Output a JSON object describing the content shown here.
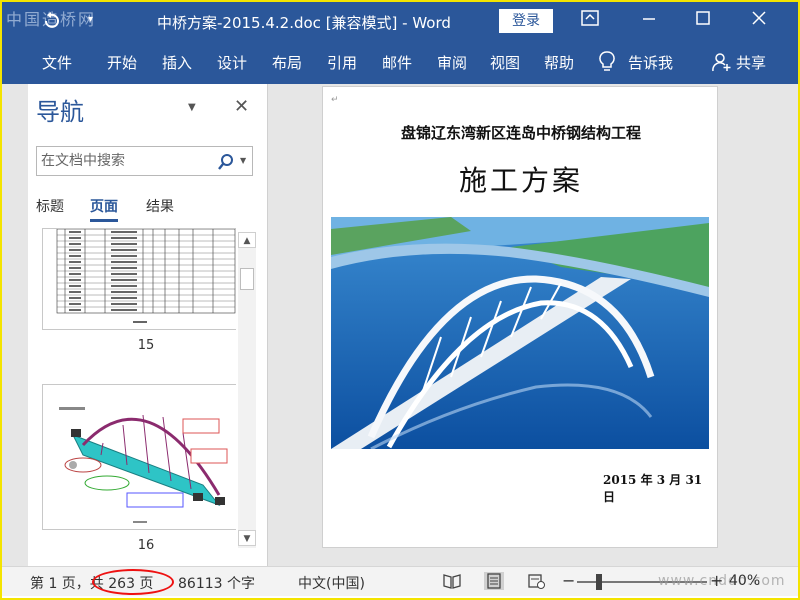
{
  "watermark": "中国造桥网",
  "window": {
    "title": "中桥方案-2015.4.2.doc [兼容模式]  -  Word",
    "login_label": "登录"
  },
  "ribbon": {
    "tabs": [
      "文件",
      "开始",
      "插入",
      "设计",
      "布局",
      "引用",
      "邮件",
      "审阅",
      "视图",
      "帮助"
    ],
    "tell_me": "告诉我",
    "share": "共享"
  },
  "nav": {
    "title": "导航",
    "search_placeholder": "在文档中搜索",
    "tabs": [
      "标题",
      "页面",
      "结果"
    ],
    "active_tab": "页面",
    "pages": [
      "15",
      "16"
    ]
  },
  "document": {
    "title": "盘锦辽东湾新区连岛中桥钢结构工程",
    "heading": "施工方案",
    "date": "2015 年 3 月 31 日"
  },
  "status": {
    "page": "第 1 页，共 263 页",
    "words": "86113 个字",
    "language": "中文(中国)",
    "zoom": "40%",
    "site_watermark": "www.cnddo.com"
  },
  "colors": {
    "word_blue": "#2b579a",
    "highlight_red": "#e11111",
    "frame_yellow": "#f4e400"
  }
}
